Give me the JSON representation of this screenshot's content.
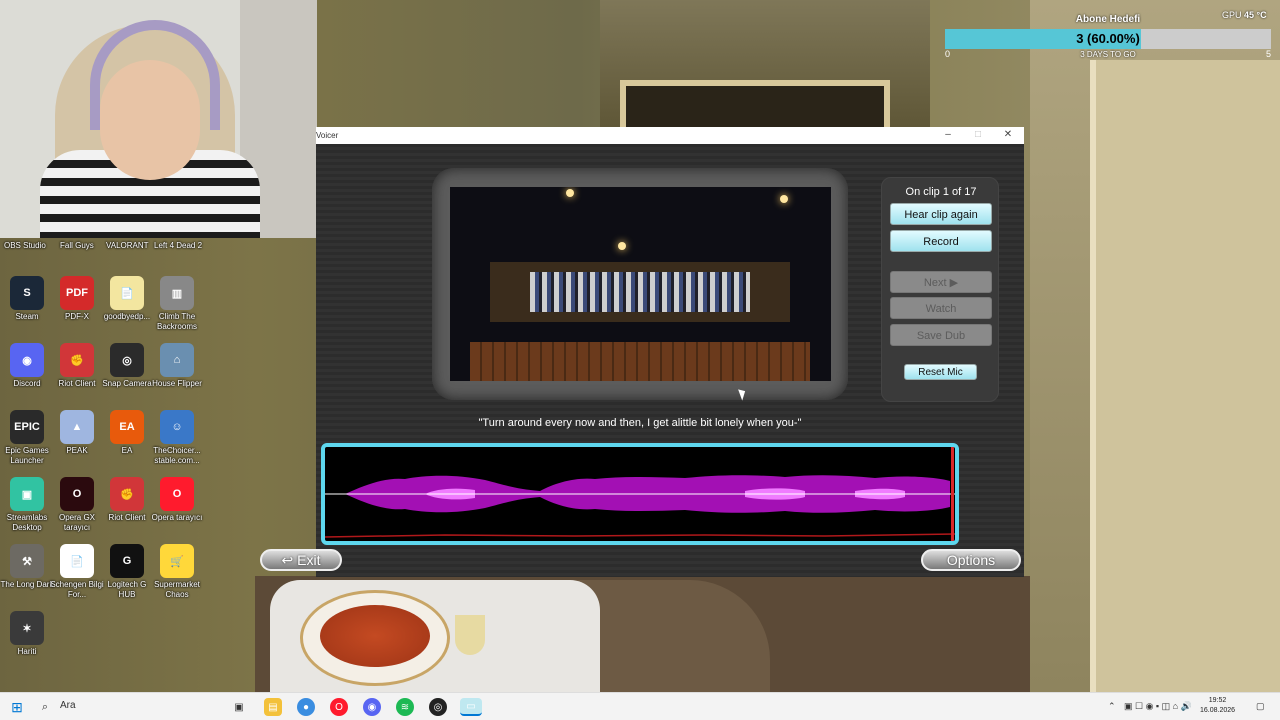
{
  "window": {
    "title": "Voicer",
    "clip_status": "On clip 1 of 17",
    "buttons": {
      "hear_again": "Hear clip again",
      "record": "Record",
      "next": "Next ▶",
      "watch": "Watch",
      "save_dub": "Save Dub",
      "reset_mic": "Reset Mic",
      "exit": "↩ Exit",
      "options": "Options"
    },
    "caption": "\"Turn around every now and then, I get alittle bit lonely when you-\""
  },
  "desktop": {
    "top_labels": [
      "OBS Studio",
      "Fall Guys",
      "VALORANT",
      "Left 4 Dead 2"
    ],
    "icons": [
      {
        "label": "Steam",
        "color": "#1b2838",
        "glyph": "S"
      },
      {
        "label": "PDF-X",
        "color": "#d42a2a",
        "glyph": "PDF"
      },
      {
        "label": "goodbyedp...",
        "color": "#f3e6a0",
        "glyph": "📄"
      },
      {
        "label": "Climb The Backrooms",
        "color": "#888",
        "glyph": "▥"
      },
      {
        "label": "Discord",
        "color": "#5865f2",
        "glyph": "◉"
      },
      {
        "label": "Riot Client",
        "color": "#d13639",
        "glyph": "✊"
      },
      {
        "label": "Snap Camera",
        "color": "#2b2b2b",
        "glyph": "◎"
      },
      {
        "label": "House Flipper",
        "color": "#6a8fb0",
        "glyph": "⌂"
      },
      {
        "label": "Epic Games Launcher",
        "color": "#2a2a2a",
        "glyph": "EPIC"
      },
      {
        "label": "PEAK",
        "color": "#9fb6e0",
        "glyph": "▲"
      },
      {
        "label": "EA",
        "color": "#e85a0c",
        "glyph": "EA"
      },
      {
        "label": "TheChoicer... stable.com...",
        "color": "#3a78c8",
        "glyph": "☺"
      },
      {
        "label": "Streamlabs Desktop",
        "color": "#31c3a2",
        "glyph": "▣"
      },
      {
        "label": "Opera GX tarayıcı",
        "color": "#2b0a0e",
        "glyph": "O"
      },
      {
        "label": "Riot Client",
        "color": "#d13639",
        "glyph": "✊"
      },
      {
        "label": "Opera tarayıcı",
        "color": "#ff1b2d",
        "glyph": "O"
      },
      {
        "label": "The Long Dark",
        "color": "#6d6a63",
        "glyph": "⚒"
      },
      {
        "label": "Schengen Bilgi For...",
        "color": "#ffffff",
        "glyph": "📄"
      },
      {
        "label": "Logitech G HUB",
        "color": "#111111",
        "glyph": "G"
      },
      {
        "label": "Supermarket Chaos",
        "color": "#ffd83a",
        "glyph": "🛒"
      },
      {
        "label": "Hariti",
        "color": "#3a3a3a",
        "glyph": "✶"
      }
    ]
  },
  "subscriber_goal": {
    "title": "Abone Hedefi",
    "value_text": "3 (60.00%)",
    "progress": 0.6,
    "subtitle": "3 DAYS TO GO",
    "min": "0",
    "max": "5"
  },
  "gpu": {
    "label": "GPU",
    "temp": "45 °C"
  },
  "taskbar": {
    "search_placeholder": "Ara",
    "time": "19:52",
    "date": "16.08.2026"
  },
  "colors": {
    "accent_cyan": "#5ed7ee",
    "wave_magenta": "#c21ad8",
    "goal_fill": "#56c6d6"
  }
}
